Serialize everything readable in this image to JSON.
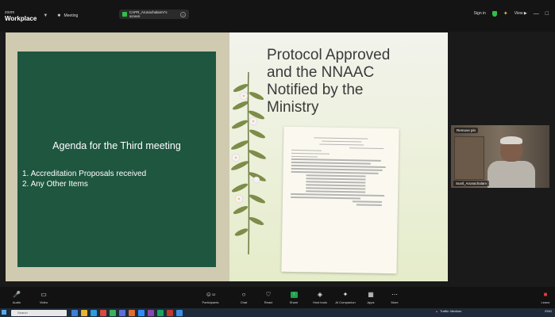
{
  "app": {
    "brand_small": "zoom",
    "brand_title": "Workplace",
    "meeting_label": "Meeting"
  },
  "share_pill": {
    "label": "CAPR_ArunachalamV's screen"
  },
  "topright": {
    "signin": "Sign in",
    "view": "View"
  },
  "slide": {
    "agenda_title": "Agenda for the Third meeting",
    "agenda_items": [
      "1.  Accreditation Proposals received",
      "2.  Any Other Items"
    ],
    "headline": "Protocol Approved and the NNAAC Notified by the Ministry"
  },
  "thumbnail": {
    "badge": "Remove pin",
    "name": "Sunil_Arunachalam"
  },
  "toolbar": {
    "audio": "Audio",
    "video": "Video",
    "participants": "Participants",
    "participants_count": "12",
    "chat": "Chat",
    "react": "React",
    "share": "Share",
    "host_tools": "Host tools",
    "ai_companion": "AI Companion",
    "apps": "Apps",
    "more": "More",
    "leave": "Leave"
  },
  "taskbar": {
    "search_placeholder": "Search",
    "weather": "Traffic: Medium",
    "lang": "ENG",
    "clock": ""
  },
  "colors": {
    "green_panel": "#1e5640",
    "share_green": "#1fa34a",
    "mic_red": "#e23b3b"
  }
}
